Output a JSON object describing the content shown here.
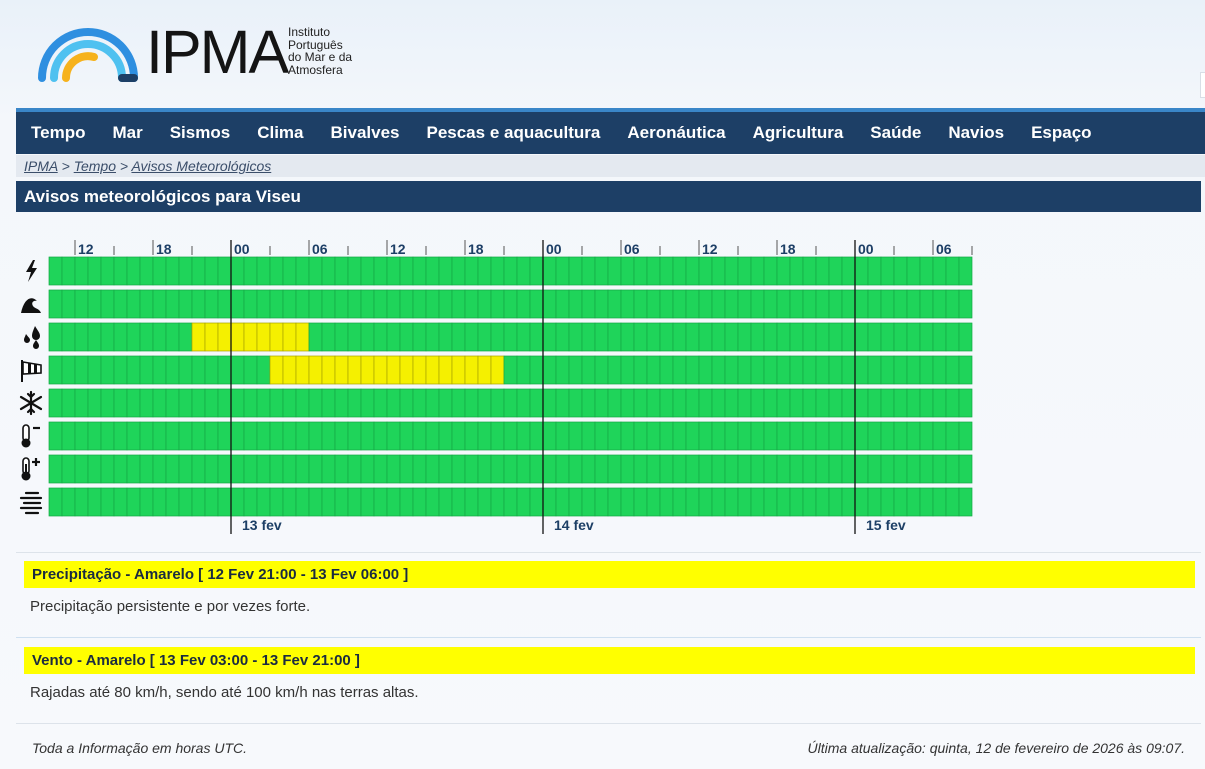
{
  "header": {
    "brand": "IPMA",
    "subtitle_lines": [
      "Instituto",
      "Português",
      "do Mar e da",
      "Atmosfera"
    ]
  },
  "nav": {
    "items": [
      "Tempo",
      "Mar",
      "Sismos",
      "Clima",
      "Bivalves",
      "Pescas e aquacultura",
      "Aeronáutica",
      "Agricultura",
      "Saúde",
      "Navios",
      "Espaço"
    ]
  },
  "breadcrumb": {
    "items": [
      "IPMA",
      "Tempo",
      "Avisos Meteorológicos"
    ],
    "separator": ">"
  },
  "page_title": "Avisos meteorológicos para Viseu",
  "timeline": {
    "hour_labels": [
      "12",
      "18",
      "00",
      "06",
      "12",
      "18",
      "00",
      "06",
      "12",
      "18",
      "00",
      "06"
    ],
    "day_labels": [
      "13 fev",
      "14 fev",
      "15 fev"
    ],
    "slots_total": 71,
    "slot_hours": 1,
    "start_hour": "12 Fev 10:00",
    "colors": {
      "green": "#1fd45a",
      "yellow": "#f5f000"
    },
    "rows": [
      {
        "icon": "thunderstorm-icon",
        "warning_level": "green"
      },
      {
        "icon": "agitacao-maritima-icon",
        "warning_level": "green"
      },
      {
        "icon": "precipitacao-icon",
        "warning_level": "yellow",
        "yellow_from": "12 Fev 21:00",
        "yellow_to": "13 Fev 06:00"
      },
      {
        "icon": "vento-icon",
        "warning_level": "yellow",
        "yellow_from": "13 Fev 03:00",
        "yellow_to": "13 Fev 21:00"
      },
      {
        "icon": "neve-icon",
        "warning_level": "green"
      },
      {
        "icon": "tempo-frio-icon",
        "warning_level": "green"
      },
      {
        "icon": "tempo-quente-icon",
        "warning_level": "green"
      },
      {
        "icon": "nevoeiro-icon",
        "warning_level": "green"
      }
    ]
  },
  "warnings": [
    {
      "header": "Precipitação - Amarelo [ 12 Fev 21:00 - 13 Fev 06:00 ]",
      "text": "Precipitação persistente e por vezes forte."
    },
    {
      "header": "Vento - Amarelo [ 13 Fev 03:00 - 13 Fev 21:00 ]",
      "text": "Rajadas até 80 km/h, sendo até 100 km/h nas terras altas."
    }
  ],
  "footer": {
    "left": "Toda a Informação em horas UTC.",
    "right": "Última atualização: quinta, 12 de fevereiro de 2026 às 09:07."
  }
}
